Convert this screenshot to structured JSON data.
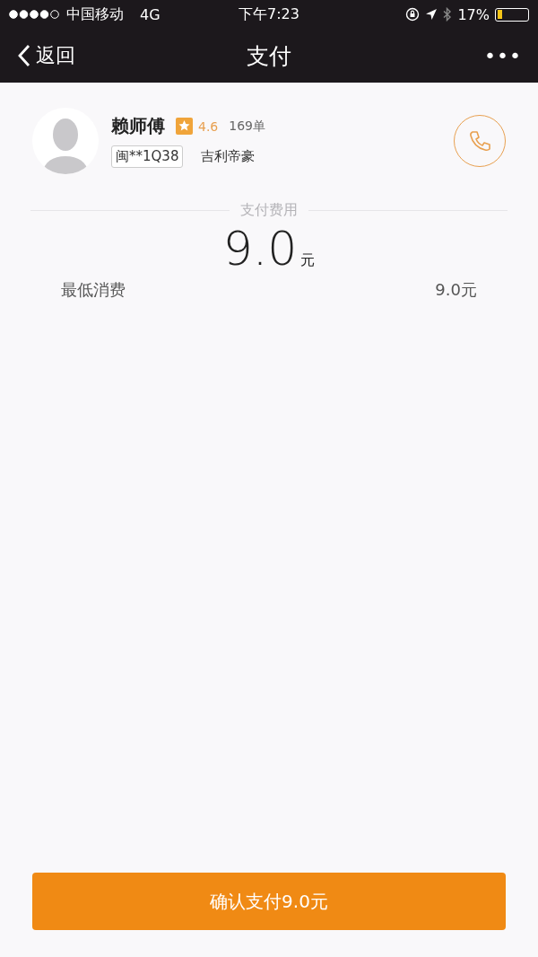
{
  "status_bar": {
    "carrier": "中国移动",
    "network": "4G",
    "time": "下午7:23",
    "battery_percent": "17%",
    "battery": {
      "level": 0.17
    }
  },
  "nav_bar": {
    "back": "返回",
    "title": "支付",
    "more": "•••"
  },
  "driver": {
    "name": "赖师傅",
    "rating": "4.6",
    "orders": "169单",
    "plate": "闽**1Q38",
    "car": "吉利帝豪"
  },
  "payment": {
    "label": "支付费用",
    "amount": "9.0",
    "unit": "元"
  },
  "lines": [
    {
      "label": "最低消费",
      "value": "9.0元"
    }
  ],
  "confirm_button": "确认支付9.0元"
}
